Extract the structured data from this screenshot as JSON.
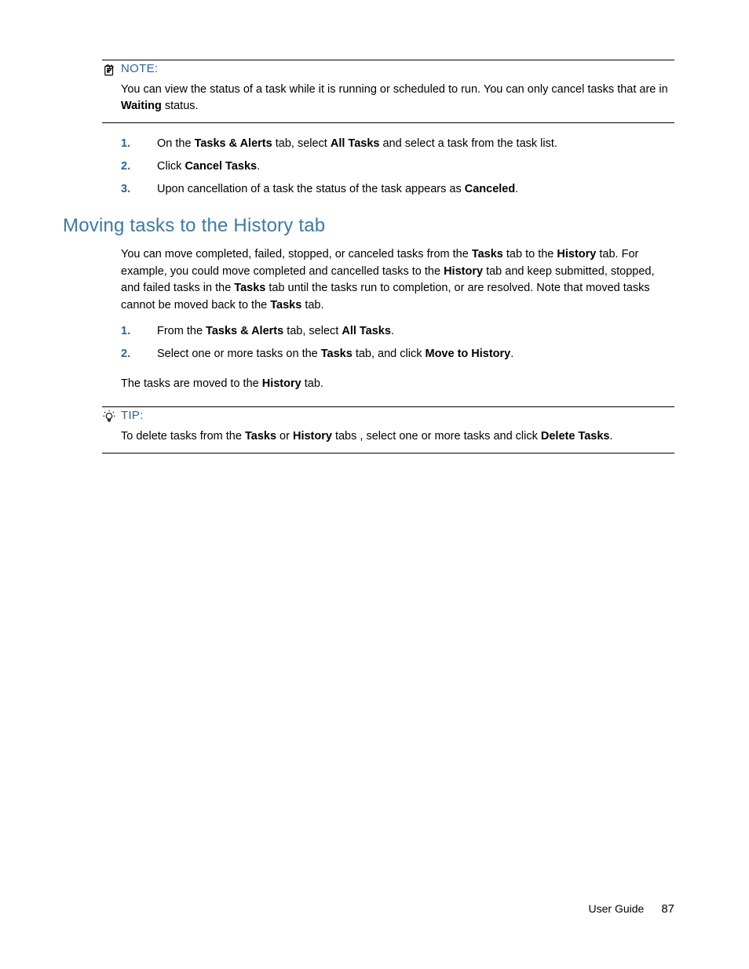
{
  "note": {
    "label": "NOTE:",
    "body_parts": [
      "You can view the status of a task while it is running or scheduled to run. You can only cancel tasks that are in ",
      "Waiting",
      " status."
    ]
  },
  "cancel_steps": [
    {
      "n": "1.",
      "parts": [
        "On the ",
        "Tasks & Alerts",
        " tab, select ",
        "All Tasks",
        " and select a task from the task list."
      ]
    },
    {
      "n": "2.",
      "parts": [
        "Click ",
        "Cancel Tasks",
        "."
      ]
    },
    {
      "n": "3.",
      "parts": [
        "Upon cancellation of a task the status of the task appears as ",
        "Canceled",
        "."
      ]
    }
  ],
  "heading": "Moving tasks to the History tab",
  "intro_parts": [
    "You can move completed, failed, stopped, or canceled tasks from the ",
    "Tasks",
    " tab to the ",
    "History",
    " tab. For example, you could move completed and cancelled tasks to the ",
    "History",
    " tab and keep submitted, stopped, and failed tasks in the ",
    "Tasks",
    " tab until the tasks run to completion, or are resolved. Note that moved tasks cannot be moved back to the ",
    "Tasks",
    " tab."
  ],
  "move_steps": [
    {
      "n": "1.",
      "parts": [
        "From the ",
        "Tasks & Alerts",
        " tab, select ",
        "All Tasks",
        "."
      ]
    },
    {
      "n": "2.",
      "parts": [
        "Select one or more tasks on the ",
        "Tasks",
        " tab, and click ",
        "Move to History",
        "."
      ]
    }
  ],
  "result_parts": [
    "The tasks are moved to the ",
    "History",
    " tab."
  ],
  "tip": {
    "label": "TIP:",
    "body_parts": [
      "To delete tasks from the ",
      "Tasks",
      " or ",
      "History",
      " tabs , select one or more tasks and click ",
      "Delete Tasks",
      "."
    ]
  },
  "footer": {
    "label": "User Guide",
    "page": "87"
  }
}
